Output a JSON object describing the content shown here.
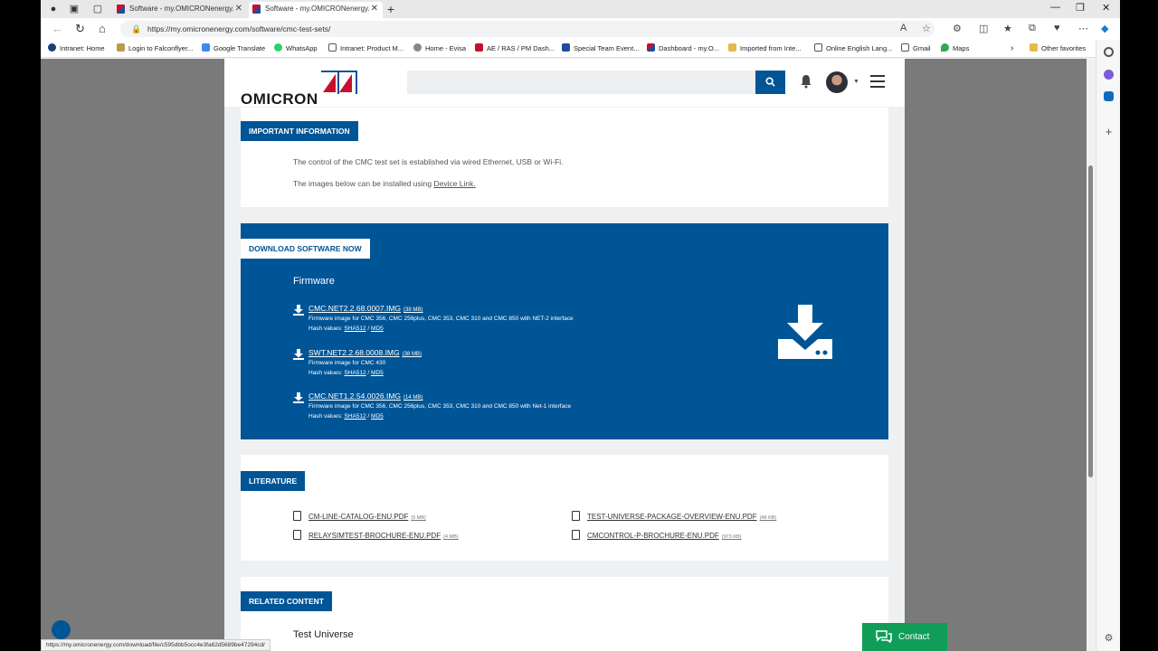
{
  "browser": {
    "tabs": [
      {
        "title": "Software - my.OMICRONenergy."
      },
      {
        "title": "Software - my.OMICRONenergy."
      }
    ],
    "url": "https://my.omicronenergy.com/software/cmc-test-sets/",
    "bookmarks": [
      "Intranet: Home",
      "Login to Falconflyer...",
      "Google Translate",
      "WhatsApp",
      "Intranet: Product M...",
      "Home - Evisa",
      "AE / RAS / PM Dash...",
      "Special Team Event...",
      "Dashboard - my.O...",
      "Imported from Inte...",
      "Online English Lang...",
      "Gmail",
      "Maps"
    ],
    "other_favorites": "Other favorites",
    "status_url": "https://my.omicronenergy.com/download/file/c595dbb5occ4e3fa62d5689be47294cd/"
  },
  "header": {
    "logo_text": "OMICRON",
    "search_placeholder": ""
  },
  "important": {
    "label": "IMPORTANT INFORMATION",
    "line1": "The control of the CMC test set is established via wired Ethernet, USB or Wi-Fi.",
    "line2_prefix": "The images below can be installed using ",
    "line2_link": "Device Link."
  },
  "download": {
    "label": "DOWNLOAD SOFTWARE NOW",
    "section_title": "Firmware",
    "items": [
      {
        "name": "CMC.NET2.2.68.0007.IMG",
        "size": "(38 MB)",
        "desc": "Firmware image for CMC 356, CMC 256plus, CMC 353, CMC 310 and CMC 850 with NET-2 interface",
        "hash_prefix": "Hash values: ",
        "sha": "SHA512",
        "sep": " / ",
        "md5": "MD5"
      },
      {
        "name": "SWT.NET2.2.68.0008.IMG",
        "size": "(38 MB)",
        "desc": "Firmware image for CMC 430",
        "hash_prefix": "Hash values: ",
        "sha": "SHA512",
        "sep": " / ",
        "md5": "MD5"
      },
      {
        "name": "CMC.NET1.2.54.0026.IMG",
        "size": "(14 MB)",
        "desc": "Firmware image for CMC 356, CMC 256plus, CMC 353, CMC 310 and CMC 850 with Net-1 interface",
        "hash_prefix": "Hash values: ",
        "sha": "SHA512",
        "sep": " / ",
        "md5": "MD5"
      }
    ]
  },
  "literature": {
    "label": "LITERATURE",
    "items": [
      {
        "name": "CM-LINE-CATALOG-ENU.PDF",
        "size": "(5 MB)"
      },
      {
        "name": "TEST-UNIVERSE-PACKAGE-OVERVIEW-ENU.PDF",
        "size": "(48 KB)"
      },
      {
        "name": "RELAYSIMTEST-BROCHURE-ENU.PDF",
        "size": "(4 MB)"
      },
      {
        "name": "CMCONTROL-P-BROCHURE-ENU.PDF",
        "size": "(973 KB)"
      }
    ]
  },
  "related": {
    "label": "RELATED CONTENT",
    "title": "Test Universe",
    "desc": ""
  },
  "contact": {
    "label": "Contact"
  },
  "colors": {
    "brand_blue": "#005596",
    "brand_red": "#c8102e",
    "contact_green": "#0f9d58"
  }
}
